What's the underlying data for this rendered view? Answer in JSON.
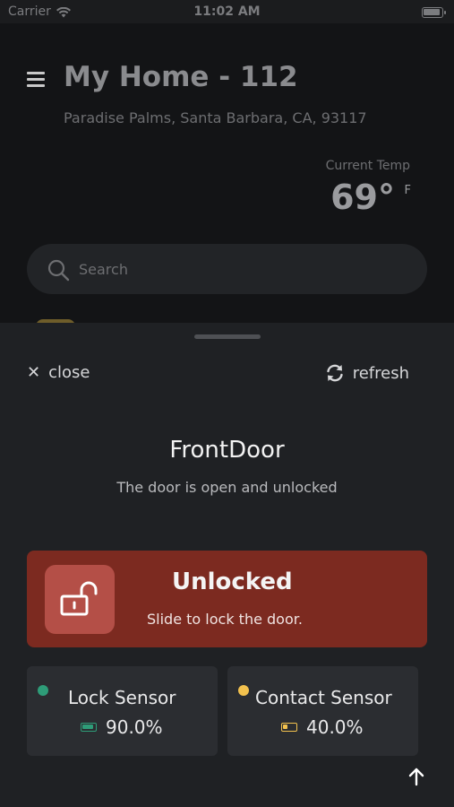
{
  "status_bar": {
    "carrier": "Carrier",
    "time": "11:02 AM"
  },
  "home": {
    "title": "My Home - 112",
    "address": "Paradise Palms, Santa Barbara, CA, 93117",
    "current_temp_label": "Current Temp",
    "current_temp_value": "69°",
    "current_temp_unit": "F",
    "search_placeholder": "Search"
  },
  "sheet": {
    "close_label": "close",
    "refresh_label": "refresh",
    "device_name": "FrontDoor",
    "device_description": "The door is open and unlocked",
    "lock": {
      "status": "Unlocked",
      "hint": "Slide to lock the door.",
      "card_color": "#7c2a20",
      "thumb_color": "#b44f47"
    },
    "sensors": [
      {
        "name": "Lock Sensor",
        "battery": "90.0%",
        "battery_level": 0.9,
        "dot_color": "#2e9c78",
        "battery_color": "#2e9c78"
      },
      {
        "name": "Contact Sensor",
        "battery": "40.0%",
        "battery_level": 0.4,
        "dot_color": "#f2c14e",
        "battery_color": "#f2c14e"
      }
    ]
  }
}
